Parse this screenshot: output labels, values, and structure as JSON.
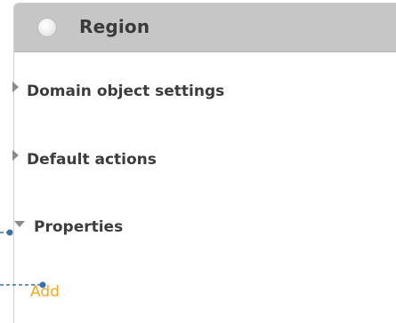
{
  "panel": {
    "title": "Region",
    "sections": [
      {
        "label": "Domain object settings",
        "state": "collapsed"
      },
      {
        "label": "Default actions",
        "state": "collapsed"
      },
      {
        "label": "Properties",
        "state": "expanded"
      }
    ],
    "add_label": "Add"
  },
  "colors": {
    "header_bg": "#c6c6c6",
    "add_link": "#f2a91e",
    "connector": "#3a6fb0"
  },
  "icons": {
    "header": "radio-circle-icon",
    "collapsed": "caret-right-icon",
    "expanded": "caret-down-icon"
  }
}
